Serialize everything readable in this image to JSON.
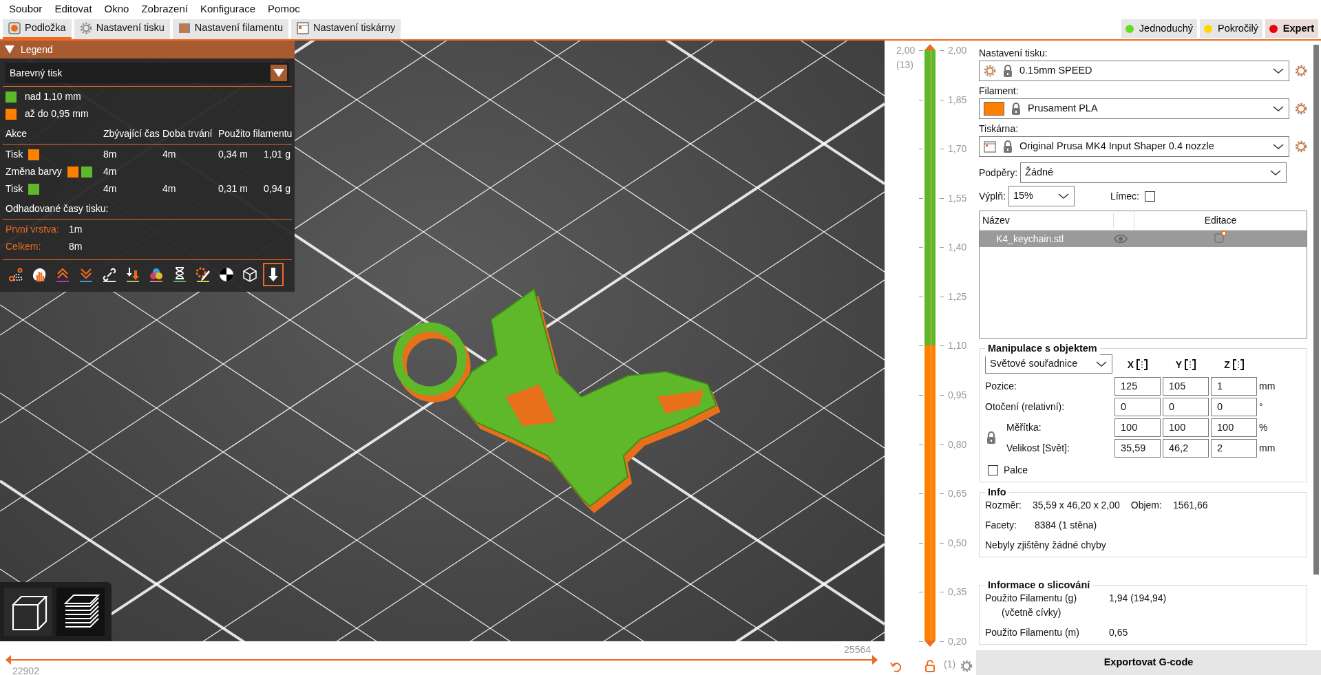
{
  "menu": [
    "Soubor",
    "Editovat",
    "Okno",
    "Zobrazení",
    "Konfigurace",
    "Pomoc"
  ],
  "tabs": [
    {
      "label": "Podložka",
      "selected": true
    },
    {
      "label": "Nastavení tisku",
      "selected": false
    },
    {
      "label": "Nastavení filamentu",
      "selected": false
    },
    {
      "label": "Nastavení tiskárny",
      "selected": false
    }
  ],
  "modes": [
    {
      "label": "Jednoduchý",
      "color": "#66dd22",
      "selected": false
    },
    {
      "label": "Pokročilý",
      "color": "#ffd700",
      "selected": false
    },
    {
      "label": "Expert",
      "color": "#e8000b",
      "selected": true
    }
  ],
  "legend": {
    "title": "Legend",
    "expanded": true,
    "view_type": "Barevný tisk",
    "ranges": [
      {
        "label": "nad 1,10 mm",
        "color": "#5eb82a"
      },
      {
        "label": "až do 0,95 mm",
        "color": "#ff7f00"
      }
    ],
    "columns": [
      "Akce",
      "Zbývající čas",
      "Doba trvání",
      "Použito filamentu"
    ],
    "rows": [
      {
        "action": "Tisk",
        "swatches": [
          {
            "color": "#ff7f00"
          }
        ],
        "remaining": "8m",
        "duration": "4m",
        "length": "0,34 m",
        "weight": "1,01 g"
      },
      {
        "action": "Změna barvy",
        "swatches": [
          {
            "color": "#ff7f00"
          },
          {
            "color": "#5eb82a"
          }
        ],
        "remaining": "4m"
      },
      {
        "action": "Tisk",
        "swatches": [
          {
            "color": "#5eb82a"
          }
        ],
        "remaining": "4m",
        "duration": "4m",
        "length": "0,31 m",
        "weight": "0,94 g"
      }
    ],
    "estimated_title": "Odhadované časy tisku:",
    "times": [
      {
        "label": "První vrstva:",
        "value": "1m"
      },
      {
        "label": "Celkem:",
        "value": "8m"
      }
    ],
    "toolbar": [
      {
        "selected": false
      },
      {
        "selected": false
      },
      {
        "selected": false
      },
      {
        "selected": false
      },
      {
        "selected": false
      },
      {
        "selected": false
      },
      {
        "selected": false
      },
      {
        "selected": false
      },
      {
        "selected": false
      },
      {
        "selected": false
      },
      {
        "selected": false
      },
      {
        "selected": true
      }
    ]
  },
  "view_buttons": [
    {
      "selected": false
    },
    {
      "selected": true
    }
  ],
  "horizontal_slider": {
    "right_label": "25564",
    "left_label": "22902",
    "level": 1
  },
  "layer_slider": {
    "top_value": "2,00",
    "top_layer": "(13)",
    "ticks": [
      "2,00",
      "1,85",
      "1,70",
      "1,55",
      "1,40",
      "1,25",
      "1,10",
      "0,95",
      "0,80",
      "0,65",
      "0,50",
      "0,35",
      "0,20"
    ],
    "bottom_layer": "(1)"
  },
  "print_settings": {
    "label": "Nastavení tisku:",
    "value": "0.15mm SPEED"
  },
  "filament": {
    "label": "Filament:",
    "value": "Prusament PLA",
    "color": "#ff7f00"
  },
  "printer": {
    "label": "Tiskárna:",
    "value": "Original Prusa MK4 Input Shaper 0.4 nozzle"
  },
  "supports": {
    "label": "Podpěry:",
    "value": "Žádné"
  },
  "infill": {
    "label": "Výplň:",
    "value": "15%"
  },
  "brim": {
    "label": "Límec:",
    "checked": false
  },
  "object_list": {
    "columns": [
      "Název",
      "Editace"
    ],
    "rows": [
      {
        "name": "K4_keychain.stl",
        "selected": true
      }
    ]
  },
  "manipulation": {
    "title": "Manipulace s objektem",
    "coordinates": "Světové souřadnice",
    "axes": [
      "X",
      "Y",
      "Z"
    ],
    "rows": [
      {
        "label": "Pozice:",
        "values": [
          "125",
          "105",
          "1"
        ],
        "unit": "mm"
      },
      {
        "label": "Otočení (relativní):",
        "values": [
          "0",
          "0",
          "0"
        ],
        "unit": "°"
      },
      {
        "label": "Měřítka:",
        "values": [
          "100",
          "100",
          "100"
        ],
        "unit": "%"
      },
      {
        "label": "Velikost [Svět]:",
        "values": [
          "35,59",
          "46,2",
          "2"
        ],
        "unit": "mm"
      }
    ],
    "inches": {
      "label": "Palce",
      "checked": false
    }
  },
  "info": {
    "title": "Info",
    "size_label": "Rozměr:",
    "size": "35,59 x 46,20 x 2,00",
    "volume_label": "Objem:",
    "volume": "1561,66",
    "facets_label": "Facety:",
    "facets": "8384 (1 stěna)",
    "message": "Nebyly zjištěny žádné chyby"
  },
  "slice_info": {
    "title": "Informace o slicování",
    "rows": [
      {
        "label": "Použito Filamentu (g)",
        "sublabel": "(včetně cívky)",
        "value": "1,94 (194,94)"
      },
      {
        "label": "Použito Filamentu (m)",
        "value": "0,65"
      }
    ]
  },
  "export_button": "Exportovat G-code"
}
